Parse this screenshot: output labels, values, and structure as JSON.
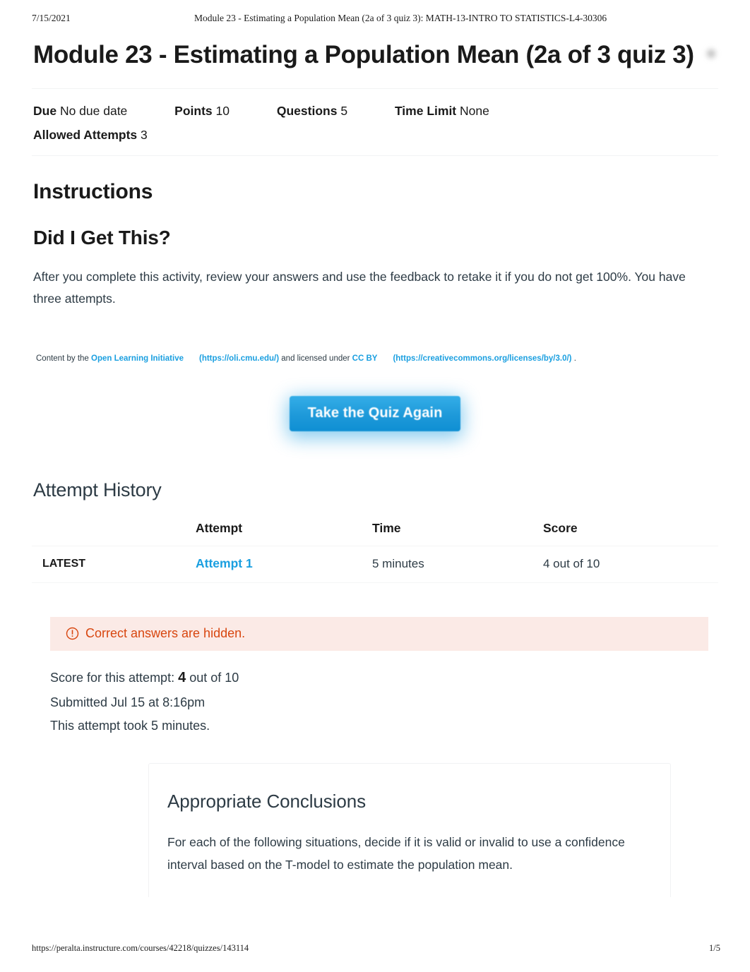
{
  "print_header": {
    "date": "7/15/2021",
    "title": "Module 23 - Estimating a Population Mean (2a of 3 quiz 3): MATH-13-INTRO TO STATISTICS-L4-30306"
  },
  "print_footer": {
    "url": "https://peralta.instructure.com/courses/42218/quizzes/143114",
    "page": "1/5"
  },
  "quiz": {
    "title": "Module 23 - Estimating a Population Mean (2a of 3 quiz 3)",
    "meta": {
      "due_label": "Due",
      "due_value": "No due date",
      "points_label": "Points",
      "points_value": "10",
      "questions_label": "Questions",
      "questions_value": "5",
      "time_limit_label": "Time Limit",
      "time_limit_value": "None",
      "allowed_attempts_label": "Allowed Attempts",
      "allowed_attempts_value": "3"
    }
  },
  "instructions": {
    "heading": "Instructions",
    "subheading": "Did I Get This?",
    "body": "After you complete this activity, review your answers and use the feedback to retake it if you do not get 100%. You have three attempts.",
    "attribution": {
      "prefix": "Content by the ",
      "link1_text": "Open Learning Initiative",
      "link1_url": "(https://oli.cmu.edu/)",
      "middle": " and licensed under ",
      "link2_text": "CC BY",
      "link2_url": "(https://creativecommons.org/licenses/by/3.0/)",
      "suffix": "."
    }
  },
  "actions": {
    "take_quiz_again": "Take the Quiz Again"
  },
  "attempt_history": {
    "heading": "Attempt History",
    "columns": [
      "",
      "Attempt",
      "Time",
      "Score"
    ],
    "rows": [
      {
        "kept": "LATEST",
        "attempt": "Attempt 1",
        "time": "5 minutes",
        "score": "4 out of 10"
      }
    ]
  },
  "result": {
    "alert": "Correct answers are hidden.",
    "alert_icon": "exclamation-circle-icon",
    "score_prefix": "Score for this attempt: ",
    "score_value": "4",
    "score_suffix": " out of 10",
    "submitted": "Submitted Jul 15 at 8:16pm",
    "duration": "This attempt took 5 minutes."
  },
  "question": {
    "title": "Appropriate Conclusions",
    "text": "For each of the following situations, decide if it is valid or invalid to use a confidence interval based on the T-model to estimate the population mean."
  },
  "colors": {
    "link_blue": "#1a9fe0",
    "button_blue": "#1f9ada",
    "alert_orange": "#d8460f",
    "alert_bg": "#fbeae6",
    "text": "#2d3b45"
  }
}
